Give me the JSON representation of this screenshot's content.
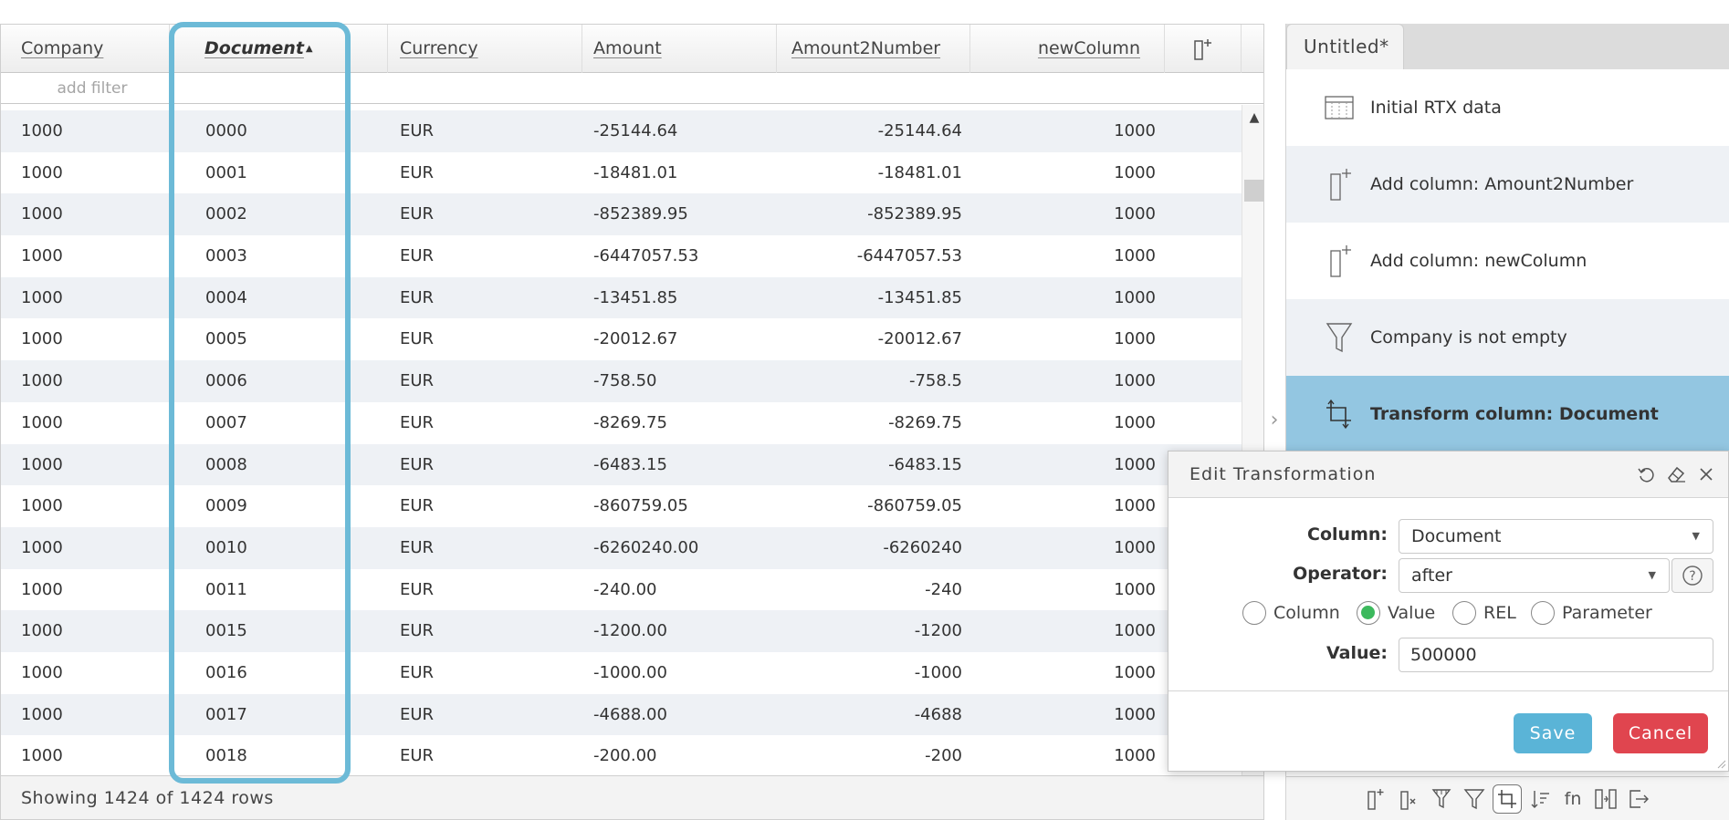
{
  "table": {
    "headers": {
      "company": "Company",
      "document": "Document",
      "document_sort": "▲",
      "currency": "Currency",
      "amount": "Amount",
      "amount2number": "Amount2Number",
      "newcolumn": "newColumn"
    },
    "filter_placeholder": "add filter",
    "rows": [
      [
        "1000",
        "0000",
        "EUR",
        "-25144.64",
        "-25144.64",
        "1000"
      ],
      [
        "1000",
        "0001",
        "EUR",
        "-18481.01",
        "-18481.01",
        "1000"
      ],
      [
        "1000",
        "0002",
        "EUR",
        "-852389.95",
        "-852389.95",
        "1000"
      ],
      [
        "1000",
        "0003",
        "EUR",
        "-6447057.53",
        "-6447057.53",
        "1000"
      ],
      [
        "1000",
        "0004",
        "EUR",
        "-13451.85",
        "-13451.85",
        "1000"
      ],
      [
        "1000",
        "0005",
        "EUR",
        "-20012.67",
        "-20012.67",
        "1000"
      ],
      [
        "1000",
        "0006",
        "EUR",
        "-758.50",
        "-758.5",
        "1000"
      ],
      [
        "1000",
        "0007",
        "EUR",
        "-8269.75",
        "-8269.75",
        "1000"
      ],
      [
        "1000",
        "0008",
        "EUR",
        "-6483.15",
        "-6483.15",
        "1000"
      ],
      [
        "1000",
        "0009",
        "EUR",
        "-860759.05",
        "-860759.05",
        "1000"
      ],
      [
        "1000",
        "0010",
        "EUR",
        "-6260240.00",
        "-6260240",
        "1000"
      ],
      [
        "1000",
        "0011",
        "EUR",
        "-240.00",
        "-240",
        "1000"
      ],
      [
        "1000",
        "0015",
        "EUR",
        "-1200.00",
        "-1200",
        "1000"
      ],
      [
        "1000",
        "0016",
        "EUR",
        "-1000.00",
        "-1000",
        "1000"
      ],
      [
        "1000",
        "0017",
        "EUR",
        "-4688.00",
        "-4688",
        "1000"
      ],
      [
        "1000",
        "0018",
        "EUR",
        "-200.00",
        "-200",
        "1000"
      ]
    ],
    "status": "Showing 1424 of 1424 rows"
  },
  "steps_panel": {
    "tab": "Untitled*",
    "steps": [
      {
        "label": "Initial RTX data",
        "icon": "table-icon"
      },
      {
        "label": "Add column: Amount2Number",
        "icon": "add-column-icon"
      },
      {
        "label": "Add column: newColumn",
        "icon": "add-column-icon"
      },
      {
        "label": "Company is not empty",
        "icon": "filter-icon"
      },
      {
        "label": "Transform column: Document",
        "icon": "transform-icon"
      }
    ]
  },
  "dialog": {
    "title": "Edit Transformation",
    "column_label": "Column:",
    "column_value": "Document",
    "operator_label": "Operator:",
    "operator_value": "after",
    "radio_options": [
      "Column",
      "Value",
      "REL",
      "Parameter"
    ],
    "selected_radio": "Value",
    "value_label": "Value:",
    "value": "500000",
    "save": "Save",
    "cancel": "Cancel"
  },
  "colors": {
    "highlight": "#6cbad7",
    "active_step": "#93c6e1",
    "save": "#5ab4d7",
    "cancel": "#e0454f",
    "radio_checked": "#3cb95d"
  }
}
